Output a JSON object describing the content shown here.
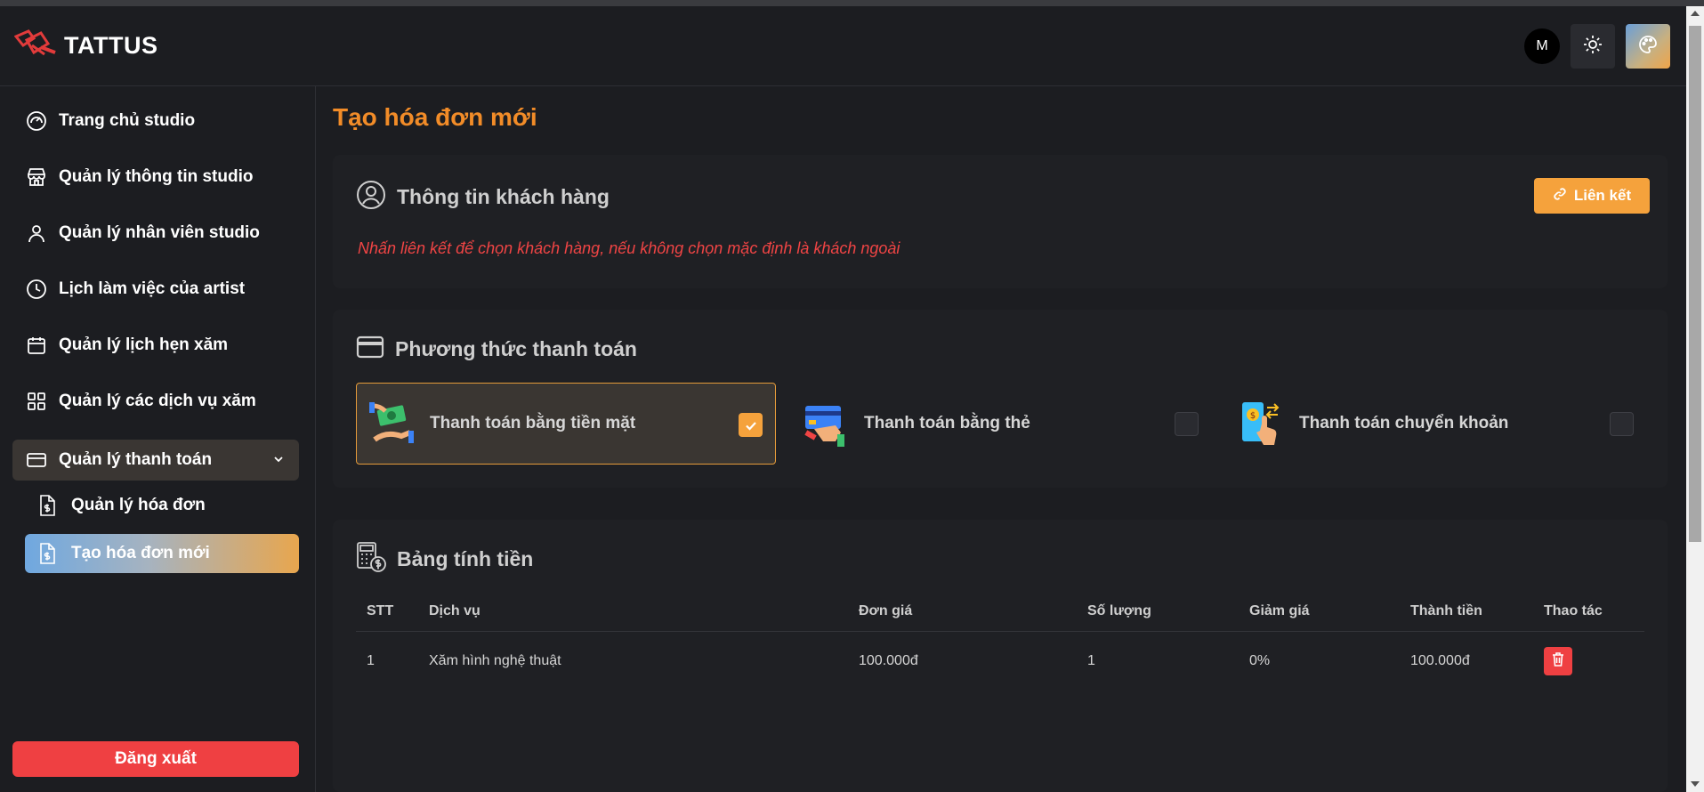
{
  "app": {
    "brand": "TATTUS"
  },
  "header": {
    "avatar_initial": "M"
  },
  "sidebar": {
    "items": [
      {
        "label": "Trang chủ studio",
        "icon": "speedometer-icon"
      },
      {
        "label": "Quản lý thông tin studio",
        "icon": "store-icon"
      },
      {
        "label": "Quản lý nhân viên studio",
        "icon": "user-icon"
      },
      {
        "label": "Lịch làm việc của artist",
        "icon": "clock-icon"
      },
      {
        "label": "Quản lý lịch hẹn xăm",
        "icon": "calendar-icon"
      },
      {
        "label": "Quản lý các dịch vụ xăm",
        "icon": "grid-icon"
      },
      {
        "label": "Quản lý thanh toán",
        "icon": "credit-card-icon"
      }
    ],
    "sub_items": [
      {
        "label": "Quản lý hóa đơn",
        "icon": "invoice-icon"
      },
      {
        "label": "Tạo hóa đơn mới",
        "icon": "invoice-icon"
      }
    ],
    "logout": "Đăng xuất"
  },
  "main": {
    "title": "Tạo hóa đơn mới",
    "customer": {
      "title": "Thông tin khách hàng",
      "link_button": "Liên kết",
      "hint": "Nhấn liên kết để chọn khách hàng, nếu không chọn mặc định là khách ngoài"
    },
    "payment": {
      "title": "Phương thức thanh toán",
      "methods": [
        {
          "label": "Thanh toán bằng tiền mặt",
          "selected": true
        },
        {
          "label": "Thanh toán bằng thẻ",
          "selected": false
        },
        {
          "label": "Thanh toán chuyển khoản",
          "selected": false
        }
      ]
    },
    "billing": {
      "title": "Bảng tính tiền",
      "columns": [
        "STT",
        "Dịch vụ",
        "Đơn giá",
        "Số lượng",
        "Giảm giá",
        "Thành tiền",
        "Thao tác"
      ],
      "rows": [
        {
          "stt": "1",
          "service": "Xăm hình nghệ thuật",
          "unit_price": "100.000đ",
          "quantity": "1",
          "discount": "0%",
          "total": "100.000đ"
        }
      ]
    }
  },
  "colors": {
    "accent": "#f28c28",
    "button": "#f5a23c",
    "danger": "#ef4042"
  }
}
